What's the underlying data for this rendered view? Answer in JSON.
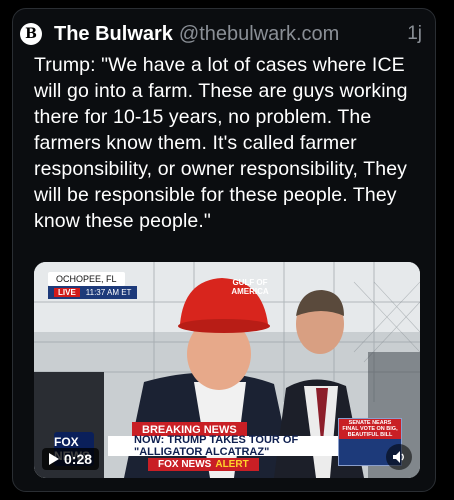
{
  "post": {
    "author_name": "The Bulwark",
    "author_handle": "@thebulwark.com",
    "timestamp": "1j",
    "avatar_letter": "B",
    "text": "Trump: \"We have a lot of cases where ICE will go into a farm. These are guys working there for 10-15 years, no problem. The farmers know them. It's called farmer responsibility, or owner responsibility, They will be responsible for these people. They know these people.\""
  },
  "video": {
    "duration": "0:28",
    "location": "OCHOPEE, FL",
    "live_label": "LIVE",
    "live_time": "11:37 AM ET",
    "hat_text": "GULF OF AMERICA",
    "breaking_label": "BREAKING NEWS",
    "headline": "NOW: TRUMP TAKES TOUR OF \"ALLIGATOR ALCATRAZ\"",
    "network_prefix": "FOX NEWS",
    "network_alert": "ALERT",
    "logo_text": "FOX NEWS",
    "side_caption": "SENATE NEARS FINAL VOTE ON BIG, BEAUTIFUL BILL",
    "play_icon": "play-icon",
    "mute_icon": "volume-icon"
  },
  "colors": {
    "card_bg": "#0b0d10",
    "text": "#ffffff",
    "muted": "#8a8f96",
    "fox_red": "#c91f25",
    "fox_blue": "#1d3a7a"
  }
}
